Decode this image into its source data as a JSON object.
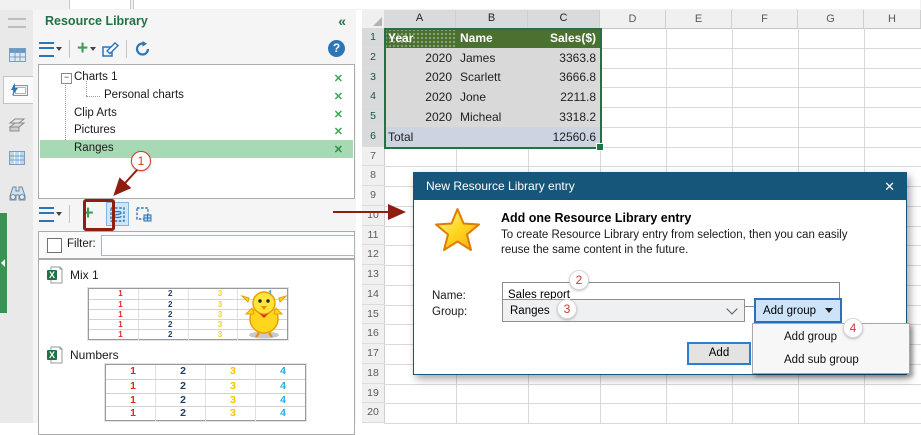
{
  "panel": {
    "title": "Resource Library",
    "collapse_icon": "«",
    "toolbar_top": {
      "menu": "menu",
      "add": "+",
      "edit": "edit",
      "refresh": "refresh",
      "help": "?"
    },
    "tree": {
      "items": [
        {
          "label": "Charts 1",
          "level": 0,
          "expander": "-",
          "selected": false
        },
        {
          "label": "Personal charts",
          "level": 1,
          "expander": "",
          "selected": false
        },
        {
          "label": "Clip Arts",
          "level": 0,
          "expander": "",
          "selected": false
        },
        {
          "label": "Pictures",
          "level": 0,
          "expander": "",
          "selected": false
        },
        {
          "label": "Ranges",
          "level": 0,
          "expander": "",
          "selected": true
        }
      ],
      "close_glyph": "✕"
    },
    "toolbar_list": {
      "menu": "menu",
      "add": "+",
      "add_selection": "add-from-selection",
      "add_range": "add-range"
    },
    "filter": {
      "label": "Filter:",
      "value": "",
      "checked": false
    },
    "library": {
      "items": [
        {
          "name": "Mix 1",
          "preview": {
            "rows": 5,
            "cols": [
              "1",
              "2",
              "3",
              "4"
            ],
            "colors": [
              "#e02b20",
              "#1f3e63",
              "#f0d42a",
              "#29abe8"
            ],
            "has_mascot": true
          }
        },
        {
          "name": "Numbers",
          "preview": {
            "rows": 4,
            "cols": [
              "1",
              "2",
              "3",
              "4"
            ],
            "colors": [
              "#e02b20",
              "#1f3e63",
              "#ffc000",
              "#29abe8"
            ],
            "has_mascot": false
          }
        }
      ]
    }
  },
  "spreadsheet": {
    "columns": [
      "A",
      "B",
      "C",
      "D",
      "E",
      "F",
      "G",
      "H"
    ],
    "selected_columns": [
      "A",
      "B",
      "C"
    ],
    "visible_rows": 20,
    "selected_rows": [
      1,
      2,
      3,
      4,
      5,
      6
    ],
    "table": {
      "headers": [
        "Year",
        "Name",
        "Sales($)"
      ],
      "rows": [
        [
          "2020",
          "James",
          "3363.8"
        ],
        [
          "2020",
          "Scarlett",
          "3666.8"
        ],
        [
          "2020",
          "Jone",
          "2211.8"
        ],
        [
          "2020",
          "Micheal",
          "3318.2"
        ]
      ],
      "total_label": "Total",
      "total_value": "12560.6"
    },
    "colors": {
      "header_fill": "#4a7130",
      "row_fill": "#d9d9d9",
      "total_fill": "#ccd3e1",
      "selection": "#217346"
    }
  },
  "dialog": {
    "title": "New Resource Library entry",
    "close_glyph": "✕",
    "heading": "Add one Resource Library entry",
    "description": "To create Resource Library entry from selection, then you can easily reuse the same content in the future.",
    "name_label": "Name:",
    "name_value": "Sales report",
    "group_label": "Group:",
    "group_value": "Ranges",
    "add_group_button": "Add group",
    "add_button": "Add",
    "menu": {
      "items": [
        "Add group",
        "Add sub group"
      ]
    },
    "title_color": "#15567a"
  },
  "annotations": {
    "step1": "1",
    "step2": "2",
    "step3": "3",
    "step4": "4",
    "arrow_color": "#8e1f10",
    "number_color": "#d03a2b"
  }
}
